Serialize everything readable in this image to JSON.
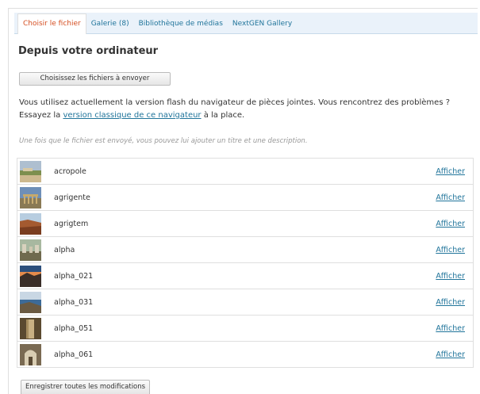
{
  "tabs": [
    {
      "label": "Choisir le fichier",
      "active": true
    },
    {
      "label": "Galerie (8)",
      "active": false
    },
    {
      "label": "Bibliothèque de médias",
      "active": false
    },
    {
      "label": "NextGEN Gallery",
      "active": false
    }
  ],
  "upload": {
    "heading": "Depuis votre ordinateur",
    "choose_button": "Choisissez les fichiers à envoyer",
    "info_text_1": "Vous utilisez actuellement la version flash du navigateur de pièces jointes. Vous rencontrez des problèmes ? Essayez la ",
    "info_link": "version classique de ce navigateur",
    "info_text_2": " à la place.",
    "hint": "Une fois que le fichier est envoyé, vous pouvez lui ajouter un titre et une description."
  },
  "files": [
    {
      "name": "acropole",
      "action": "Afficher",
      "thumb": "landscape-ruins"
    },
    {
      "name": "agrigente",
      "action": "Afficher",
      "thumb": "temple"
    },
    {
      "name": "agrigtem",
      "action": "Afficher",
      "thumb": "canyon"
    },
    {
      "name": "alpha",
      "action": "Afficher",
      "thumb": "ruins-stones"
    },
    {
      "name": "alpha_021",
      "action": "Afficher",
      "thumb": "sunset-mountain"
    },
    {
      "name": "alpha_031",
      "action": "Afficher",
      "thumb": "rocky-sea"
    },
    {
      "name": "alpha_051",
      "action": "Afficher",
      "thumb": "column"
    },
    {
      "name": "alpha_061",
      "action": "Afficher",
      "thumb": "cave"
    }
  ],
  "footer": {
    "save_button": "Enregistrer toutes les modifications"
  },
  "colors": {
    "link": "#21759b",
    "active_tab": "#d54e21",
    "tabbar_bg": "#eaf2fa",
    "border": "#dfdfdf"
  }
}
